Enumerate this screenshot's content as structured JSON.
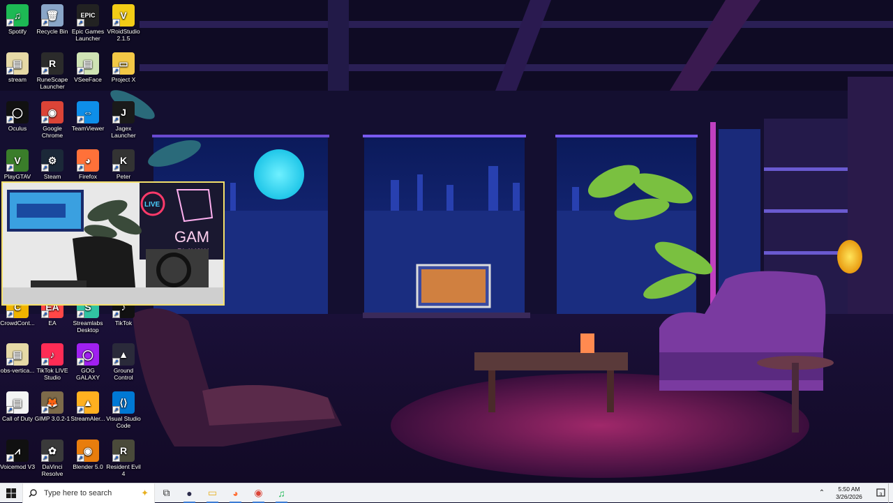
{
  "desktop": {
    "icons": [
      {
        "label": "Spotify",
        "icon": "spotify-icon",
        "color": "#1db954",
        "glyph": "♫"
      },
      {
        "label": "Recycle Bin",
        "icon": "recycle-bin-icon",
        "color": "#8aa6c8",
        "glyph": "🗑"
      },
      {
        "label": "Epic Games Launcher",
        "icon": "epic-games-icon",
        "color": "#222222",
        "glyph": "EPIC"
      },
      {
        "label": "VRoidStudio 2.1.5",
        "icon": "vroid-icon",
        "color": "#f2cc16",
        "glyph": "V"
      },
      {
        "label": "stream",
        "icon": "file-icon",
        "color": "#e6d9a6",
        "glyph": "▤"
      },
      {
        "label": "RuneScape Launcher",
        "icon": "runescape-icon",
        "color": "#2b2b2b",
        "glyph": "R"
      },
      {
        "label": "VSeeFace",
        "icon": "file-icon",
        "color": "#cfe3b4",
        "glyph": "▤"
      },
      {
        "label": "Project X",
        "icon": "folder-icon",
        "color": "#f3c846",
        "glyph": "▭"
      },
      {
        "label": "Oculus",
        "icon": "oculus-icon",
        "color": "#111111",
        "glyph": "◯"
      },
      {
        "label": "Google Chrome",
        "icon": "chrome-icon",
        "color": "#db4437",
        "glyph": "◉"
      },
      {
        "label": "TeamViewer",
        "icon": "teamviewer-icon",
        "color": "#0e8ee9",
        "glyph": "⇔"
      },
      {
        "label": "Jagex Launcher",
        "icon": "jagex-icon",
        "color": "#1a1a1a",
        "glyph": "J"
      },
      {
        "label": "PlayGTAV",
        "icon": "gtav-icon",
        "color": "#3a7d2a",
        "glyph": "V"
      },
      {
        "label": "Steam",
        "icon": "steam-icon",
        "color": "#1b2838",
        "glyph": "⚙"
      },
      {
        "label": "Firefox",
        "icon": "firefox-icon",
        "color": "#ff7139",
        "glyph": "◕"
      },
      {
        "label": "Peter",
        "icon": "peter-icon",
        "color": "#333333",
        "glyph": "K"
      },
      {
        "label": "CrowdCont...",
        "icon": "crowdcontrol-icon",
        "color": "#f0b400",
        "glyph": "C"
      },
      {
        "label": "EA",
        "icon": "ea-icon",
        "color": "#ff4747",
        "glyph": "EA"
      },
      {
        "label": "Streamlabs Desktop",
        "icon": "streamlabs-icon",
        "color": "#31c3a2",
        "glyph": "S"
      },
      {
        "label": "TikTok",
        "icon": "tiktok-icon",
        "color": "#111111",
        "glyph": "♪"
      },
      {
        "label": "obs-vertica...",
        "icon": "file-icon",
        "color": "#e6d9a6",
        "glyph": "▤"
      },
      {
        "label": "TikTok LIVE Studio",
        "icon": "tiktok-live-icon",
        "color": "#fe2c55",
        "glyph": "♪"
      },
      {
        "label": "GOG GALAXY",
        "icon": "gog-icon",
        "color": "#a020f0",
        "glyph": "◯"
      },
      {
        "label": "Ground Control",
        "icon": "ground-control-icon",
        "color": "#2a2a3a",
        "glyph": "▲"
      },
      {
        "label": "Call of Duty",
        "icon": "file-icon",
        "color": "#f4f4f4",
        "glyph": "▤"
      },
      {
        "label": "GIMP 3.0.2-1",
        "icon": "gimp-icon",
        "color": "#7d6a4a",
        "glyph": "🦊"
      },
      {
        "label": "StreamAler...",
        "icon": "streamalerts-icon",
        "color": "#ffb020",
        "glyph": "▲"
      },
      {
        "label": "Visual Studio Code",
        "icon": "vscode-icon",
        "color": "#0078d4",
        "glyph": "⟨⟩"
      },
      {
        "label": "Voicemod V3",
        "icon": "voicemod-icon",
        "color": "#101010",
        "glyph": "⩘"
      },
      {
        "label": "DaVinci Resolve",
        "icon": "davinci-icon",
        "color": "#3a3a3a",
        "glyph": "✿"
      },
      {
        "label": "Blender 5.0",
        "icon": "blender-icon",
        "color": "#e87d0d",
        "glyph": "◉"
      },
      {
        "label": "Resident Evil 4",
        "icon": "re4-icon",
        "color": "#4a4a3a",
        "glyph": "R"
      }
    ]
  },
  "webcam": {
    "sign_live": "LIVE",
    "sign_text": "GAM",
    "sign_sub": "PLAY&W"
  },
  "taskbar": {
    "search_placeholder": "Type here to search",
    "pinned": [
      {
        "name": "task-view-icon",
        "glyph": "⧉"
      },
      {
        "name": "obs-icon",
        "glyph": "●"
      },
      {
        "name": "file-explorer-icon",
        "glyph": "▭"
      },
      {
        "name": "firefox-icon",
        "glyph": "◕"
      },
      {
        "name": "chrome-icon",
        "glyph": "◉"
      },
      {
        "name": "spotify-icon",
        "glyph": "♫"
      }
    ],
    "time": "5:50 AM",
    "date": "3/26/2026",
    "notification_count": "3"
  }
}
